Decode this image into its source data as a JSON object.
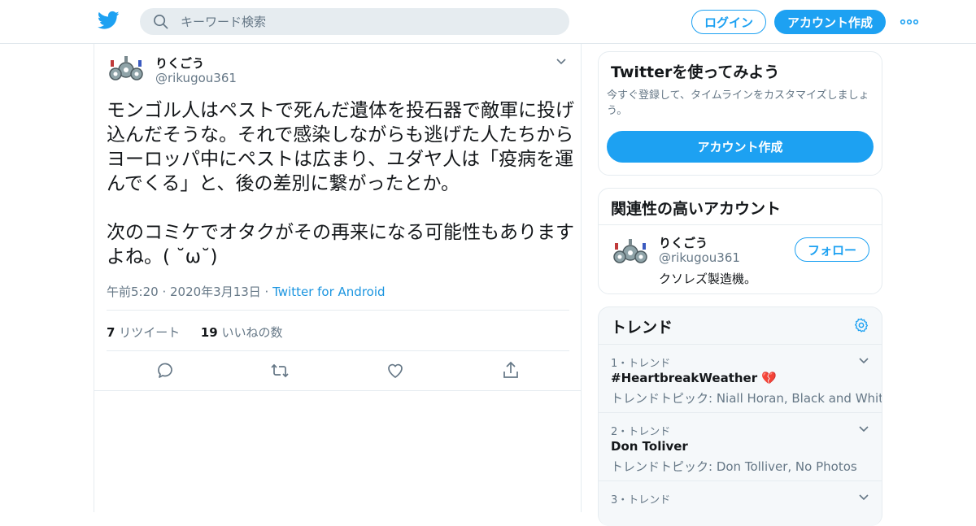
{
  "header": {
    "search_placeholder": "キーワード検索",
    "login_label": "ログイン",
    "signup_label": "アカウント作成"
  },
  "tweet": {
    "author_name": "りくごう",
    "author_handle": "@rikugou361",
    "text": "モンゴル人はペストで死んだ遺体を投石器で敵軍に投げ込んだそうな。それで感染しながらも逃げた人たちからヨーロッパ中にペストは広まり、ユダヤ人は「疫病を運んでくる」と、後の差別に繋がったとか。\n\n次のコミケでオタクがその再来になる可能性もありますよね。( ˘ω˘)",
    "timestamp": "午前5:20 · 2020年3月13日 · ",
    "source": "Twitter for Android",
    "retweet_count": "7",
    "retweet_label": "リツイート",
    "like_count": "19",
    "like_label": "いいねの数"
  },
  "signup_card": {
    "title": "Twitterを使ってみよう",
    "description": "今すぐ登録して、タイムラインをカスタマイズしましょう。",
    "button_label": "アカウント作成"
  },
  "related_card": {
    "title": "関連性の高いアカウント",
    "name": "りくごう",
    "handle": "@rikugou361",
    "bio": "クソレズ製造機。",
    "follow_label": "フォロー"
  },
  "trends_card": {
    "title": "トレンド",
    "items": [
      {
        "rank": "1・トレンド",
        "name": "#HeartbreakWeather 💔",
        "topic": "トレンドトピック: Niall Horan, Black and White"
      },
      {
        "rank": "2・トレンド",
        "name": "Don Toliver",
        "topic": "トレンドトピック: Don Tolliver, No Photos"
      },
      {
        "rank": "3・トレンド",
        "name": "",
        "topic": ""
      }
    ]
  },
  "colors": {
    "accent": "#1da1f2",
    "link": "#1b95e0",
    "muted": "#657786",
    "border": "#e6ecf0"
  }
}
